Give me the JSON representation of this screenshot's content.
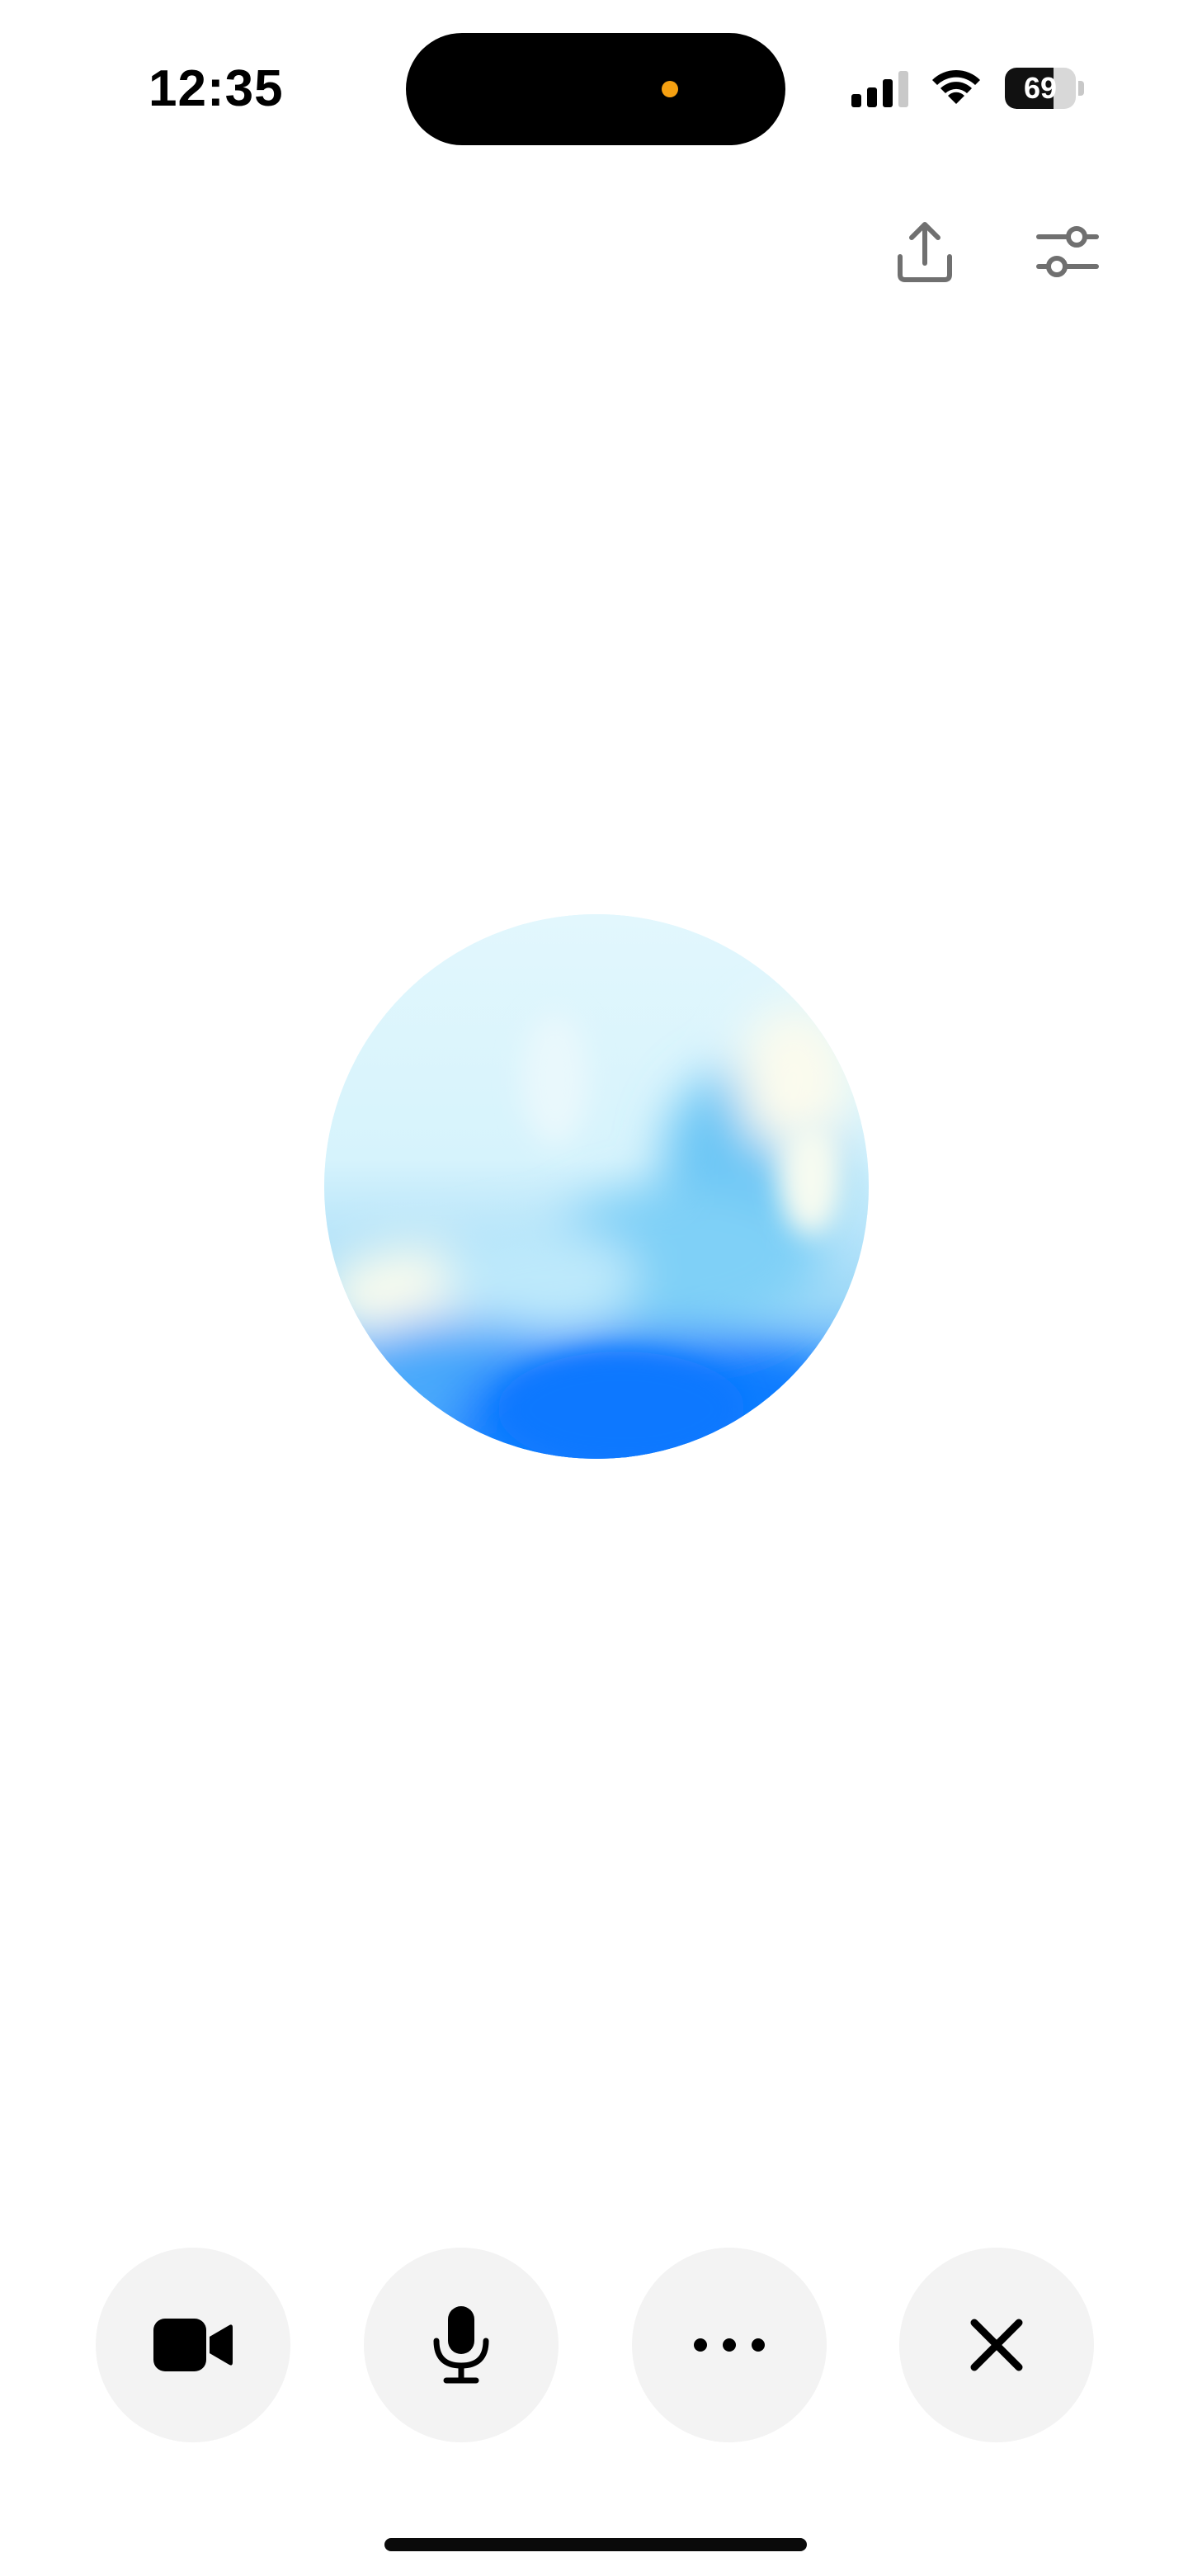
{
  "status_bar": {
    "time": "12:35",
    "battery_level": "69",
    "battery_fraction": 0.69,
    "signal_icon": "cellular-signal-icon",
    "wifi_icon": "wifi-icon"
  },
  "toolbar": {
    "share_icon": "share-upload-icon",
    "settings_icon": "sliders-settings-icon"
  },
  "orb": {
    "icon": "voice-orb",
    "colors": [
      "#dff6fd",
      "#bfe9fb",
      "#5ebcf6",
      "#0a7cff",
      "#fbfbee"
    ]
  },
  "controls": {
    "video_icon": "video-camera-icon",
    "mic_icon": "microphone-icon",
    "more_icon": "more-ellipsis-icon",
    "close_icon": "close-icon"
  },
  "colors": {
    "control_background": "#f3f3f3",
    "icon_gray": "#7a7a7a",
    "island_indicator": "#f5a011"
  }
}
